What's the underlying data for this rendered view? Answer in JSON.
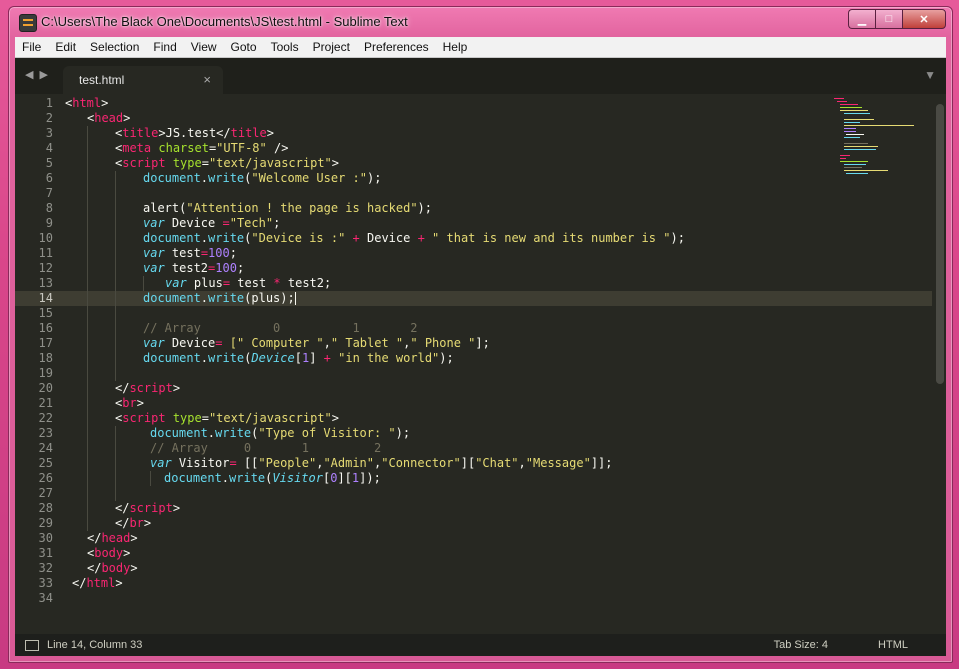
{
  "window": {
    "title": "C:\\Users\\The Black One\\Documents\\JS\\test.html - Sublime Text"
  },
  "menu": [
    "File",
    "Edit",
    "Selection",
    "Find",
    "View",
    "Goto",
    "Tools",
    "Project",
    "Preferences",
    "Help"
  ],
  "tabs": [
    {
      "label": "test.html",
      "close": "×"
    }
  ],
  "status": {
    "position": "Line 14, Column 33",
    "tab_size": "Tab Size: 4",
    "syntax": "HTML"
  },
  "editor": {
    "current_line": 14,
    "line_numbers": [
      "1",
      "2",
      "3",
      "4",
      "5",
      "6",
      "7",
      "8",
      "9",
      "10",
      "11",
      "12",
      "13",
      "14",
      "15",
      "16",
      "17",
      "18",
      "19",
      "20",
      "21",
      "22",
      "23",
      "24",
      "25",
      "26",
      "27",
      "28",
      "29",
      "30",
      "31",
      "32",
      "33",
      "34"
    ],
    "code": {
      "l1": [
        "<",
        "html",
        ">"
      ],
      "l2": [
        "<",
        "head",
        ">"
      ],
      "l3": [
        "<",
        "title",
        ">",
        "JS.test",
        "</",
        "title",
        ">"
      ],
      "l4": [
        "<",
        "meta",
        " charset",
        "=",
        "\"UTF-8\"",
        " />"
      ],
      "l5": [
        "<",
        "script",
        " type",
        "=",
        "\"text/javascript\"",
        ">"
      ],
      "l6": [
        "document",
        ".",
        "write",
        "(",
        "\"Welcome User :\"",
        ");"
      ],
      "l8": [
        "alert",
        "(",
        "\"Attention ! the page is hacked\"",
        ");"
      ],
      "l9": [
        "var",
        " Device ",
        "=",
        "\"Tech\"",
        ";"
      ],
      "l10": [
        "document",
        ".",
        "write",
        "(",
        "\"Device is :\"",
        " + ",
        "Device",
        " + ",
        "\" that is new and its number is \"",
        ");"
      ],
      "l11": [
        "var",
        " test",
        "=",
        "100",
        ";"
      ],
      "l12": [
        "var",
        " test2",
        "=",
        "100",
        ";"
      ],
      "l13": [
        "var",
        " plus",
        "=",
        " test ",
        "*",
        " test2;"
      ],
      "l14": [
        "document",
        ".",
        "write",
        "(plus);"
      ],
      "l16": "// Array          0          1       2",
      "l17": [
        "var",
        " Device",
        "=",
        " [\" Computer \"",
        ",",
        "\" Tablet \"",
        ",",
        "\" Phone \"",
        "];"
      ],
      "l18": [
        "document",
        ".",
        "write",
        "(",
        "Device",
        "[",
        "1",
        "] ",
        "+",
        " \"in the world\"",
        ");"
      ],
      "l20": [
        "</",
        "script",
        ">"
      ],
      "l21": [
        "<",
        "br",
        ">"
      ],
      "l22": [
        "<",
        "script",
        " type",
        "=",
        "\"text/javascript\"",
        ">"
      ],
      "l23": [
        "document",
        ".",
        "write",
        "(",
        "\"Type of Visitor: \"",
        ");"
      ],
      "l24": "// Array     0       1         2",
      "l25": [
        "var",
        " Visitor",
        "=",
        " [[",
        "\"People\"",
        ",",
        "\"Admin\"",
        ",",
        "\"Connector\"",
        "][",
        "\"Chat\"",
        ",",
        "\"Message\"",
        "]];"
      ],
      "l26": [
        "document",
        ".",
        "write",
        "(",
        "Visitor",
        "[",
        "0",
        "][",
        "1",
        "]);"
      ],
      "l28": [
        "</",
        "script",
        ">"
      ],
      "l29": [
        "</",
        "br",
        ">"
      ],
      "l30": [
        "</",
        "head",
        ">"
      ],
      "l31": [
        "<",
        "body",
        ">"
      ],
      "l32": [
        "</",
        "body",
        ">"
      ],
      "l33": [
        "</",
        "html",
        ">"
      ]
    }
  },
  "colors": {
    "editor_bg": "#272822",
    "tag": "#f92672",
    "attr": "#a6e22e",
    "string": "#e6db74",
    "keyword": "#66d9ef",
    "number": "#ae81ff",
    "comment": "#75715e",
    "text": "#f8f8f2"
  }
}
